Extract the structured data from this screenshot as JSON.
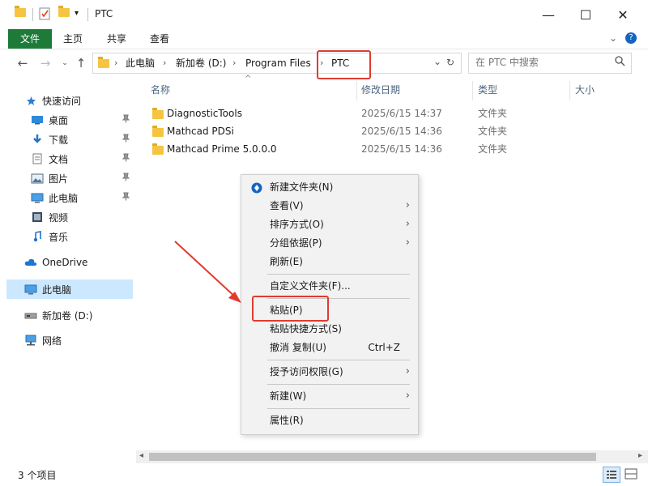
{
  "window": {
    "title": "PTC",
    "controls": {
      "minimize": "—",
      "maximize": "☐",
      "close": "✕"
    },
    "help": "?"
  },
  "ribbon": {
    "tabs": [
      "文件",
      "主页",
      "共享",
      "查看"
    ]
  },
  "address": {
    "breadcrumbs": [
      "此电脑",
      "新加卷 (D:)",
      "Program Files",
      "PTC"
    ],
    "search_placeholder": "在 PTC 中搜索"
  },
  "nav": {
    "quick_access": "快速访问",
    "items": [
      {
        "label": "桌面",
        "icon": "desktop-icon",
        "pinned": true
      },
      {
        "label": "下载",
        "icon": "download-icon",
        "pinned": true
      },
      {
        "label": "文档",
        "icon": "document-icon",
        "pinned": true
      },
      {
        "label": "图片",
        "icon": "picture-icon",
        "pinned": true
      },
      {
        "label": "此电脑",
        "icon": "computer-icon",
        "pinned": true
      },
      {
        "label": "视频",
        "icon": "video-icon",
        "pinned": false
      },
      {
        "label": "音乐",
        "icon": "music-icon",
        "pinned": false
      }
    ],
    "onedrive": "OneDrive",
    "this_pc": "此电脑",
    "drive": "新加卷 (D:)",
    "network": "网络"
  },
  "columns": {
    "name": "名称",
    "date": "修改日期",
    "type": "类型",
    "size": "大小"
  },
  "files": [
    {
      "name": "DiagnosticTools",
      "date": "2025/6/15 14:37",
      "type": "文件夹"
    },
    {
      "name": "Mathcad PDSi",
      "date": "2025/6/15 14:36",
      "type": "文件夹"
    },
    {
      "name": "Mathcad Prime 5.0.0.0",
      "date": "2025/6/15 14:36",
      "type": "文件夹"
    }
  ],
  "context_menu": {
    "new_folder": "新建文件夹(N)",
    "view": "查看(V)",
    "sort": "排序方式(O)",
    "group": "分组依据(P)",
    "refresh": "刷新(E)",
    "customize": "自定义文件夹(F)...",
    "paste": "粘贴(P)",
    "paste_shortcut": "粘贴快捷方式(S)",
    "undo": "撤消 复制(U)",
    "undo_shortcut": "Ctrl+Z",
    "grant_access": "授予访问权限(G)",
    "new": "新建(W)",
    "properties": "属性(R)"
  },
  "status": {
    "count": "3 个项目"
  },
  "colors": {
    "accent_green": "#1e7a39",
    "selection": "#cce8ff",
    "annotation_red": "#e03b2f",
    "folder": "#f5c542"
  }
}
